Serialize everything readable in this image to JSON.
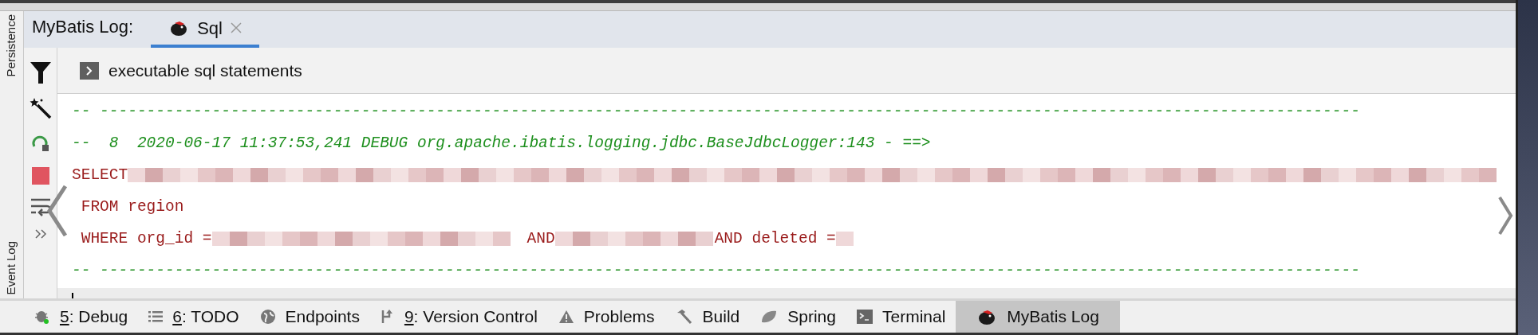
{
  "side_labels": [
    "Persistence",
    "Event Log"
  ],
  "tool_window": {
    "title": "MyBatis Log:",
    "tabs": [
      {
        "label": "Sql",
        "selected": true,
        "closable": true
      }
    ]
  },
  "group": {
    "label": "executable sql statements",
    "expanded": false
  },
  "console": {
    "lines": [
      {
        "kind": "separator",
        "text": "-- ---------------------------------------------------------------------------------------------------------------------------------------"
      },
      {
        "kind": "comment",
        "text": "--  8  2020-06-17 11:37:53,241 DEBUG org.apache.ibatis.logging.jdbc.BaseJdbcLogger:143 - ==>"
      },
      {
        "kind": "sql",
        "segments": [
          {
            "kind": "text",
            "text": "SELECT"
          },
          {
            "kind": "redacted"
          }
        ]
      },
      {
        "kind": "sql",
        "segments": [
          {
            "kind": "text",
            "text": " FROM region"
          }
        ]
      },
      {
        "kind": "sql",
        "segments": [
          {
            "kind": "text",
            "text": " WHERE org_id ="
          },
          {
            "kind": "redacted"
          },
          {
            "kind": "text",
            "text": "AND"
          },
          {
            "kind": "redacted"
          },
          {
            "kind": "text",
            "text": "AND deleted ="
          },
          {
            "kind": "redacted"
          }
        ]
      },
      {
        "kind": "separator",
        "text": "-- ---------------------------------------------------------------------------------------------------------------------------------------"
      },
      {
        "kind": "cursor"
      }
    ]
  },
  "tool_tabs": [
    {
      "kind": "debug",
      "mnemonic": "5",
      "label": ": Debug",
      "selected": false
    },
    {
      "kind": "todo",
      "mnemonic": "6",
      "label": ": TODO",
      "selected": false
    },
    {
      "kind": "endpoints",
      "label": "Endpoints",
      "selected": false
    },
    {
      "kind": "vcs",
      "mnemonic": "9",
      "label": ": Version Control",
      "selected": false
    },
    {
      "kind": "problems",
      "label": "Problems",
      "selected": false
    },
    {
      "kind": "build",
      "label": "Build",
      "selected": false
    },
    {
      "kind": "spring",
      "label": "Spring",
      "selected": false
    },
    {
      "kind": "terminal",
      "label": "Terminal",
      "selected": false
    },
    {
      "kind": "mybatis",
      "label": "MyBatis Log",
      "selected": true
    }
  ]
}
